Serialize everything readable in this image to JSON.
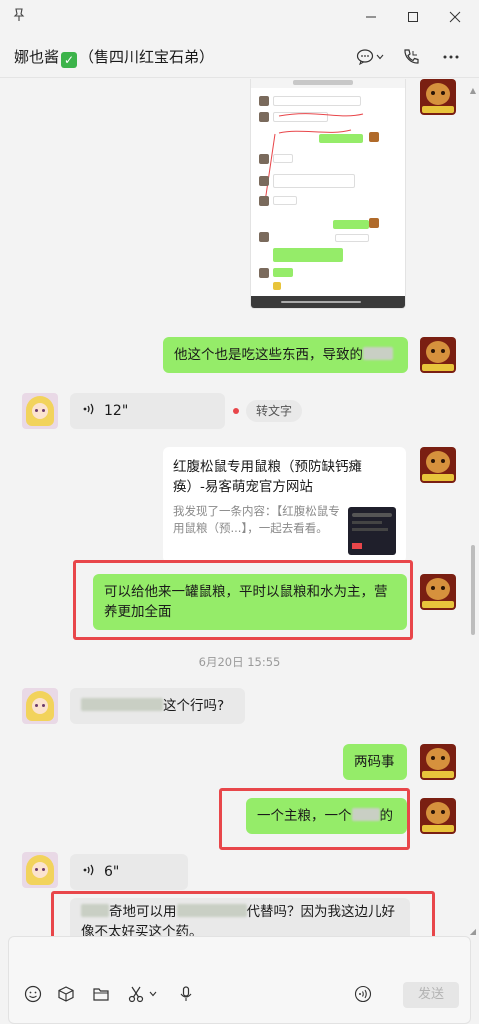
{
  "window": {
    "title_name": "娜也酱",
    "title_suffix": "（售四川红宝石弟）",
    "verified_mark": "✓"
  },
  "messages": {
    "m1_text": "他这个也是吃这些东西，导致的",
    "voice1_duration": "12\"",
    "voice1_convert": "转文字",
    "card_title": "红腹松鼠专用鼠粮（预防缺钙瘫痪）-易客萌宠官方网站",
    "card_desc": "我发现了一条内容：【红腹松鼠专用鼠粮（预...】，一起去看看。",
    "m2_text": "可以给他来一罐鼠粮，平时以鼠粮和水为主，营养更加全面",
    "timestamp": "6月20日 15:55",
    "m3_text": "这个行吗?",
    "m4_text": "两码事",
    "m5_text_a": "一个主粮，一个",
    "m5_text_b": "的",
    "voice2_duration": "6\"",
    "m6_text_a": "奇地可以用",
    "m6_text_b": "代替吗？因为我这边儿好像不太好买这个药。"
  },
  "composer": {
    "send_label": "发送"
  },
  "icons": {
    "pin": "pin-icon",
    "chat": "chat-icon",
    "call": "phone-icon",
    "more": "more-icon"
  }
}
